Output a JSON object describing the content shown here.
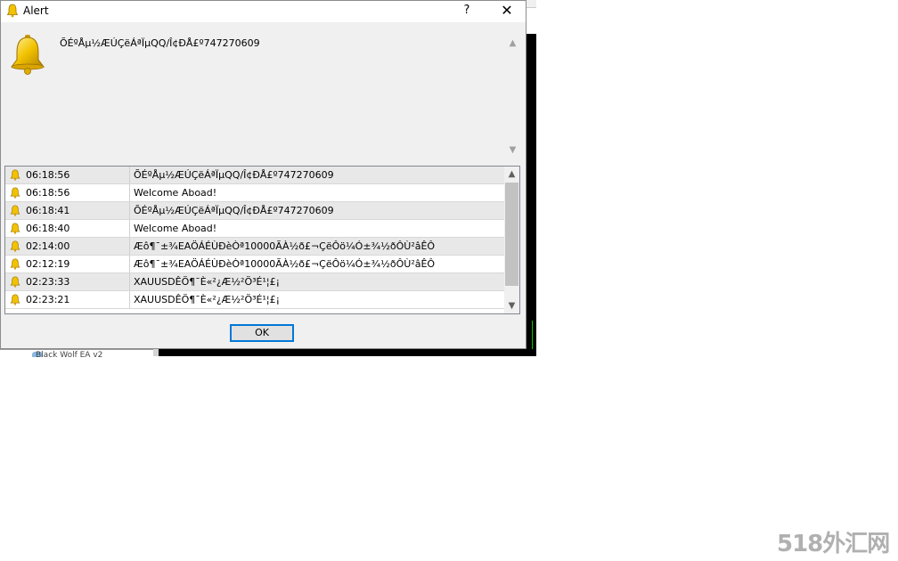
{
  "dialog": {
    "title": "Alert",
    "help_label": "?",
    "close_label": "✕",
    "message": "ÕÉºÅµ½ÆÚÇëÁªÏµQQ/Î¢ÐÅ£º747270609",
    "ok_label": "OK",
    "scroll_up": "▲",
    "scroll_down": "▼"
  },
  "alerts": [
    {
      "time": "06:18:56",
      "text": "ÕÉºÅµ½ÆÚÇëÁªÏµQQ/Î¢ÐÅ£º747270609"
    },
    {
      "time": "06:18:56",
      "text": "Welcome Aboad!"
    },
    {
      "time": "06:18:41",
      "text": "ÕÉºÅµ½ÆÚÇëÁªÏµQQ/Î¢ÐÅ£º747270609"
    },
    {
      "time": "06:18:40",
      "text": "Welcome Aboad!"
    },
    {
      "time": "02:14:00",
      "text": "Æô¶¯±¾EAÖÁÉÙÐèÒª10000ÃÀ½ð£¬ÇëÔö¼Ó±¾½ðÔÙ²âÊÔ"
    },
    {
      "time": "02:12:19",
      "text": "Æô¶¯±¾EAÖÁÉÙÐèÒª10000ÃÀ½ð£¬ÇëÔö¼Ó±¾½ðÔÙ²âÊÔ"
    },
    {
      "time": "02:23:33",
      "text": "XAUUSDÊÖ¶¯È«²¿Æ½²Ö³É¹¦£¡"
    },
    {
      "time": "02:23:21",
      "text": "XAUUSDÊÖ¶¯È«²¿Æ½²Ö³É¹¦£¡"
    }
  ],
  "colors": {
    "bell": "#f2c200",
    "accent": "#0078d7"
  },
  "icons": {
    "alert": "bell-icon"
  },
  "background": {
    "navigator_item": "Black Wolf EA v2"
  },
  "watermark": "518外汇网"
}
